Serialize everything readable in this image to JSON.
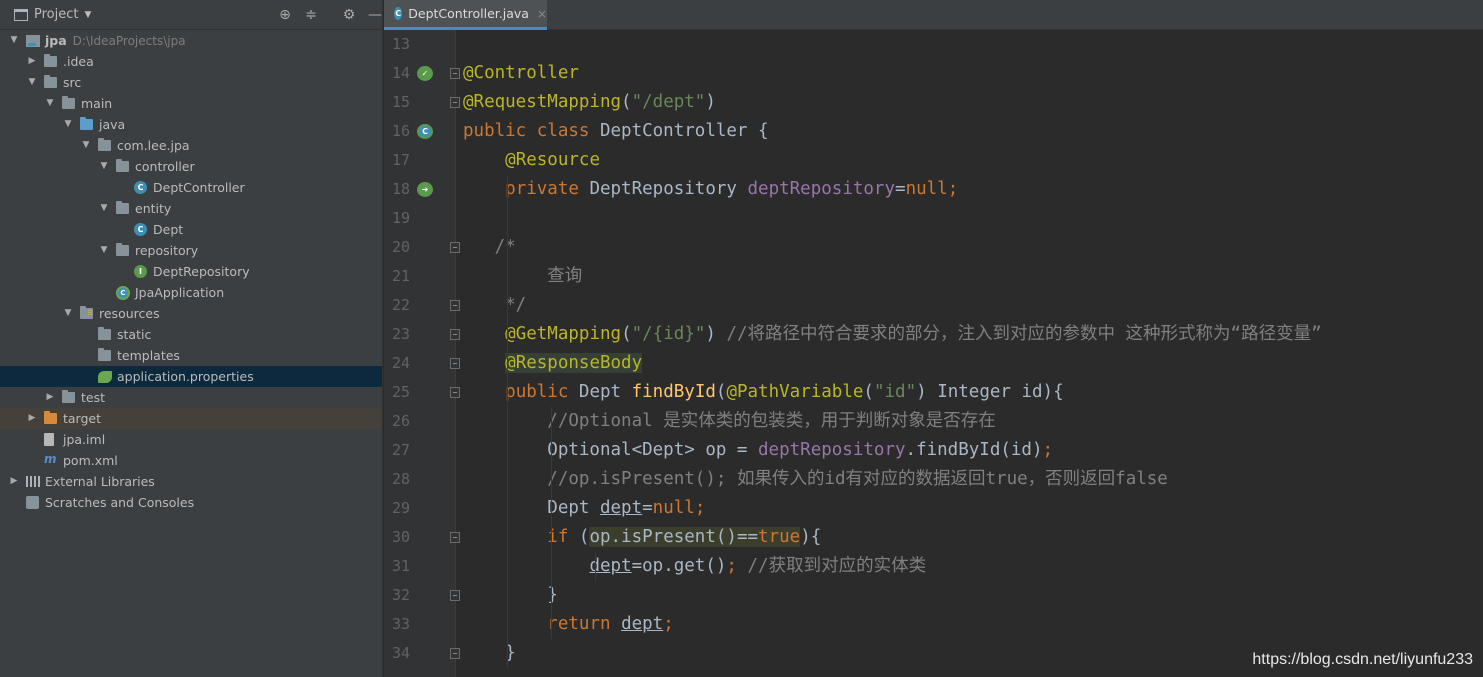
{
  "project_panel": {
    "title": "Project",
    "tree": [
      {
        "label": "jpa",
        "path": "D:\\IdeaProjects\\jpa",
        "icon": "project-folder-icon",
        "depth": 0,
        "expanded": true
      },
      {
        "label": ".idea",
        "icon": "folder-icon",
        "depth": 1,
        "expanded": false
      },
      {
        "label": "src",
        "icon": "folder-icon",
        "depth": 1,
        "expanded": true
      },
      {
        "label": "main",
        "icon": "folder-icon",
        "depth": 2,
        "expanded": true
      },
      {
        "label": "java",
        "icon": "source-folder-icon",
        "depth": 3,
        "expanded": true
      },
      {
        "label": "com.lee.jpa",
        "icon": "package-icon",
        "depth": 4,
        "expanded": true
      },
      {
        "label": "controller",
        "icon": "package-icon",
        "depth": 5,
        "expanded": true
      },
      {
        "label": "DeptController",
        "icon": "class-icon",
        "depth": 6
      },
      {
        "label": "entity",
        "icon": "package-icon",
        "depth": 5,
        "expanded": true
      },
      {
        "label": "Dept",
        "icon": "class-icon",
        "depth": 6
      },
      {
        "label": "repository",
        "icon": "package-icon",
        "depth": 5,
        "expanded": true
      },
      {
        "label": "DeptRepository",
        "icon": "interface-icon",
        "depth": 6
      },
      {
        "label": "JpaApplication",
        "icon": "spring-boot-app-icon",
        "depth": 5
      },
      {
        "label": "resources",
        "icon": "resources-folder-icon",
        "depth": 3,
        "expanded": true
      },
      {
        "label": "static",
        "icon": "folder-icon",
        "depth": 4
      },
      {
        "label": "templates",
        "icon": "folder-icon",
        "depth": 4
      },
      {
        "label": "application.properties",
        "icon": "properties-icon",
        "depth": 4,
        "selected": true
      },
      {
        "label": "test",
        "icon": "folder-icon",
        "depth": 2,
        "expanded": false
      },
      {
        "label": "target",
        "icon": "excluded-folder-icon",
        "depth": 1,
        "expanded": false,
        "excluded": true
      },
      {
        "label": "jpa.iml",
        "icon": "iml-file-icon",
        "depth": 1
      },
      {
        "label": "pom.xml",
        "icon": "maven-icon",
        "depth": 1
      },
      {
        "label": "External Libraries",
        "icon": "libraries-icon",
        "depth": 0,
        "expanded": false
      },
      {
        "label": "Scratches and Consoles",
        "icon": "scratches-icon",
        "depth": 0
      }
    ]
  },
  "editor": {
    "tab": {
      "label": "DeptController.java",
      "close": "×"
    },
    "lines": [
      {
        "n": "13",
        "segs": []
      },
      {
        "n": "14",
        "mark": "bean-icon",
        "fold": true,
        "segs": [
          [
            "ann",
            "@Controller"
          ]
        ]
      },
      {
        "n": "15",
        "fold": true,
        "segs": [
          [
            "ann",
            "@RequestMapping"
          ],
          [
            "",
            "("
          ],
          [
            "str",
            "\"/dept\""
          ],
          [
            "",
            ")"
          ]
        ]
      },
      {
        "n": "16",
        "mark": "spring-bean-class-icon",
        "segs": [
          [
            "kw",
            "public class "
          ],
          [
            "",
            "DeptController {"
          ]
        ]
      },
      {
        "n": "17",
        "segs": [
          [
            "",
            "    "
          ],
          [
            "ann",
            "@Resource"
          ]
        ]
      },
      {
        "n": "18",
        "mark": "autowired-icon",
        "segs": [
          [
            "",
            "    "
          ],
          [
            "kw",
            "private "
          ],
          [
            "",
            "DeptRepository "
          ],
          [
            "fld",
            "deptRepository"
          ],
          [
            "",
            "="
          ],
          [
            "kw",
            "null;"
          ]
        ]
      },
      {
        "n": "19",
        "segs": []
      },
      {
        "n": "20",
        "fold": true,
        "segs": [
          [
            "",
            "   "
          ],
          [
            "cmt",
            "/*"
          ]
        ]
      },
      {
        "n": "21",
        "segs": [
          [
            "cmt",
            "        查询"
          ]
        ]
      },
      {
        "n": "22",
        "fold": true,
        "segs": [
          [
            "cmt",
            "    */"
          ]
        ]
      },
      {
        "n": "23",
        "fold": true,
        "segs": [
          [
            "",
            "    "
          ],
          [
            "ann",
            "@GetMapping"
          ],
          [
            "",
            "("
          ],
          [
            "str",
            "\"/{id}\""
          ],
          [
            "",
            ") "
          ],
          [
            "cmt",
            "//将路径中符合要求的部分，注入到对应的参数中 这种形式称为“路径变量”"
          ]
        ]
      },
      {
        "n": "24",
        "fold": true,
        "segs": [
          [
            "",
            "    "
          ],
          [
            "ann hl2",
            "@ResponseBody"
          ]
        ]
      },
      {
        "n": "25",
        "fold": true,
        "segs": [
          [
            "",
            "    "
          ],
          [
            "kw",
            "public "
          ],
          [
            "",
            "Dept "
          ],
          [
            "fn",
            "findById"
          ],
          [
            "",
            "("
          ],
          [
            "ann",
            "@PathVariable"
          ],
          [
            "",
            "("
          ],
          [
            "str",
            "\"id\""
          ],
          [
            "",
            ") Integer id){"
          ]
        ]
      },
      {
        "n": "26",
        "segs": [
          [
            "",
            "        "
          ],
          [
            "cmt",
            "//Optional 是实体类的包装类，用于判断对象是否存在"
          ]
        ]
      },
      {
        "n": "27",
        "segs": [
          [
            "",
            "        Optional<Dept> op = "
          ],
          [
            "fld",
            "deptRepository"
          ],
          [
            "",
            ".findById(id)"
          ],
          [
            "kw",
            ";"
          ]
        ]
      },
      {
        "n": "28",
        "segs": [
          [
            "",
            "        "
          ],
          [
            "cmt",
            "//op.isPresent(); 如果传入的id有对应的数据返回true，否则返回false"
          ]
        ]
      },
      {
        "n": "29",
        "segs": [
          [
            "",
            "        Dept "
          ],
          [
            "u",
            "dept"
          ],
          [
            "",
            "="
          ],
          [
            "kw",
            "null;"
          ]
        ]
      },
      {
        "n": "30",
        "fold": true,
        "segs": [
          [
            "",
            "        "
          ],
          [
            "kw",
            "if "
          ],
          [
            "",
            "("
          ],
          [
            "hl",
            "op.isPresent()=="
          ],
          [
            "kw hl",
            "true"
          ],
          [
            "",
            "){"
          ]
        ]
      },
      {
        "n": "31",
        "segs": [
          [
            "",
            "            "
          ],
          [
            "u",
            "dept"
          ],
          [
            "",
            "=op.get()"
          ],
          [
            "kw",
            "; "
          ],
          [
            "cmt",
            "//获取到对应的实体类"
          ]
        ]
      },
      {
        "n": "32",
        "fold": true,
        "segs": [
          [
            "",
            "        }"
          ]
        ]
      },
      {
        "n": "33",
        "segs": [
          [
            "",
            "        "
          ],
          [
            "kw",
            "return "
          ],
          [
            "u",
            "dept"
          ],
          [
            "kw",
            ";"
          ]
        ]
      },
      {
        "n": "34",
        "fold": true,
        "segs": [
          [
            "",
            "    }"
          ]
        ]
      }
    ]
  },
  "watermark": "https://blog.csdn.net/liyunfu233",
  "colors": {
    "keyword": "#cc7832",
    "annotation": "#bbb529",
    "string": "#6a8759",
    "field": "#9876aa",
    "comment": "#808080",
    "method": "#ffc66d",
    "text": "#a9b7c6"
  }
}
